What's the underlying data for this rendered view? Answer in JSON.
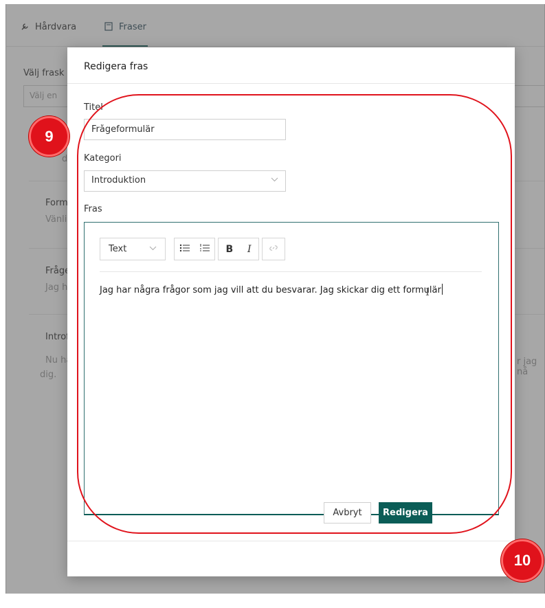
{
  "background": {
    "tabs": [
      {
        "icon": "wrench-icon",
        "label": "Hårdvara"
      },
      {
        "icon": "document-icon",
        "label": "Fraser"
      }
    ],
    "category_label": "Välj frask",
    "category_placeholder": "Välj en",
    "partial_d": "d",
    "rows": [
      {
        "title": "Form",
        "snippet": "Vänli"
      },
      {
        "title": "Fråge",
        "snippet": "Jag h"
      },
      {
        "title": "Introf",
        "snippet": "Nu ha"
      }
    ],
    "row_right_text": "r jag nå",
    "row_continuation": "dig."
  },
  "modal": {
    "title": "Redigera fras",
    "title_field": {
      "label": "Titel",
      "value": "Frågeformulär"
    },
    "category_field": {
      "label": "Kategori",
      "value": "Introduktion"
    },
    "phrase_field": {
      "label": "Fras",
      "toolbar": {
        "text_style": "Text",
        "bold": "B",
        "italic": "I"
      },
      "content": "Jag har några frågor som jag vill att du besvarar. Jag skickar dig ett formulär"
    },
    "cancel_label": "Avbryt",
    "submit_label": "Redigera"
  },
  "annotations": {
    "step_a": "9",
    "step_b": "10",
    "accent_color": "#e0121b",
    "primary_color": "#0b5d57"
  }
}
